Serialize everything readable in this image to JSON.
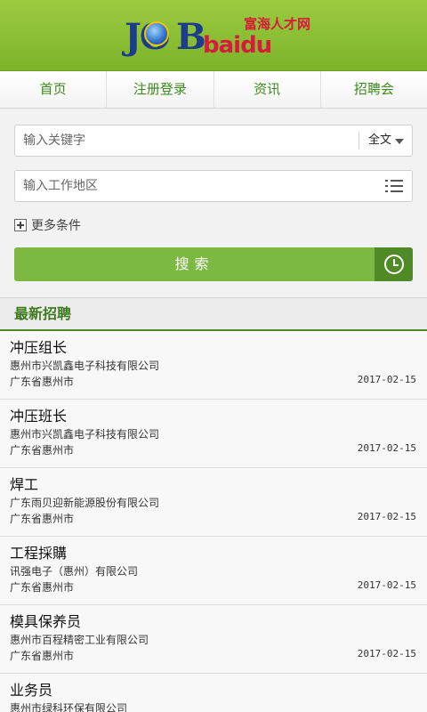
{
  "header": {
    "logo_jo": "JO",
    "logo_b": "B",
    "logo_baidu": "baidu",
    "logo_cn": "富海人才网"
  },
  "nav": {
    "items": [
      {
        "label": "首页"
      },
      {
        "label": "注册登录"
      },
      {
        "label": "资讯"
      },
      {
        "label": "招聘会"
      }
    ]
  },
  "search": {
    "keyword_placeholder": "输入关键字",
    "scope_label": "全文",
    "location_placeholder": "输入工作地区",
    "more_label": "更多条件",
    "button_label": "搜索"
  },
  "section": {
    "title": "最新招聘"
  },
  "jobs": [
    {
      "title": "冲压组长",
      "company": "惠州市兴凯鑫电子科技有限公司",
      "location": "广东省惠州市",
      "date": "2017-02-15"
    },
    {
      "title": "冲压班长",
      "company": "惠州市兴凯鑫电子科技有限公司",
      "location": "广东省惠州市",
      "date": "2017-02-15"
    },
    {
      "title": "焊工",
      "company": "广东雨贝迎新能源股份有限公司",
      "location": "广东省惠州市",
      "date": "2017-02-15"
    },
    {
      "title": "工程採購",
      "company": "讯强电子（惠州）有限公司",
      "location": "广东省惠州市",
      "date": "2017-02-15"
    },
    {
      "title": "模具保养员",
      "company": "惠州市百程精密工业有限公司",
      "location": "广东省惠州市",
      "date": "2017-02-15"
    },
    {
      "title": "业务员",
      "company": "惠州市绿科环保有限公司",
      "location": "",
      "date": ""
    }
  ],
  "colors": {
    "header_green": "#8cc136",
    "accent_green": "#4f8a26",
    "button_green": "#7db843"
  }
}
